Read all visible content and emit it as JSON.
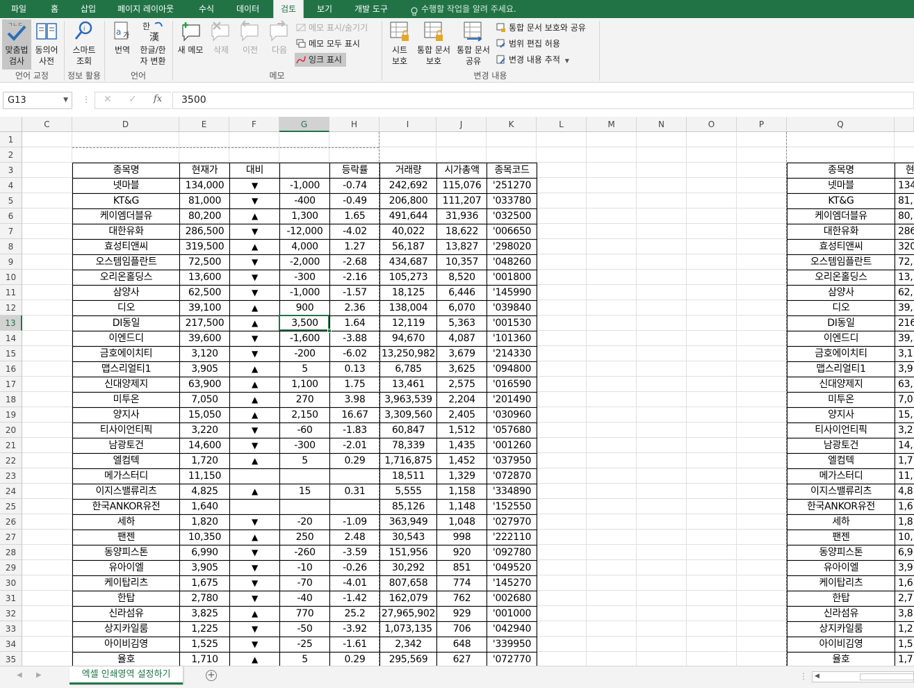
{
  "ribbon_tabs": [
    "파일",
    "홈",
    "삽입",
    "페이지 레이아웃",
    "수식",
    "데이터",
    "검토",
    "보기",
    "개발 도구"
  ],
  "active_tab": "검토",
  "tell_me": "수행할 작업을 알려 주세요.",
  "ribbon": {
    "spell": [
      "맞춤법",
      "검사"
    ],
    "thesaurus": [
      "동의어",
      "사전"
    ],
    "smart_lookup": [
      "스마트",
      "조회"
    ],
    "translate": "번역",
    "hanja": [
      "한글/한",
      "자 변환"
    ],
    "new_comment": "새 메모",
    "delete": "삭제",
    "previous": "이전",
    "next": "다음",
    "show_hide_comment": "메모 표시/숨기기",
    "show_all_comments": "메모 모두 표시",
    "show_ink": "잉크 표시",
    "protect_sheet": [
      "시트",
      "보호"
    ],
    "protect_workbook": [
      "통합 문서",
      "보호"
    ],
    "share_workbook": [
      "통합 문서",
      "공유"
    ],
    "protect_share": "통합 문서 보호와 공유",
    "allow_edit_ranges": "범위 편집 허용",
    "track_changes": "변경 내용 추적",
    "groups": [
      "언어 교정",
      "정보 활용",
      "언어",
      "메모",
      "변경 내용"
    ]
  },
  "name_box": "G13",
  "formula": "3500",
  "columns": [
    "C",
    "D",
    "E",
    "F",
    "G",
    "H",
    "I",
    "J",
    "K",
    "L",
    "M",
    "N",
    "O",
    "P",
    "Q"
  ],
  "rows": [
    "1",
    "2",
    "3",
    "4",
    "5",
    "6",
    "7",
    "8",
    "9",
    "10",
    "11",
    "12",
    "13",
    "14",
    "15",
    "16",
    "17",
    "18",
    "19",
    "20",
    "21",
    "22",
    "23",
    "24",
    "25",
    "26",
    "27",
    "28",
    "29",
    "30",
    "31",
    "32",
    "33",
    "34",
    "35"
  ],
  "table_header": [
    "종목명",
    "현재가",
    "대비",
    "",
    "등락률",
    "거래량",
    "시가총액",
    "종목코드"
  ],
  "table": [
    [
      "넷마블",
      "134,000",
      "▼",
      "-1,000",
      "-0.74",
      "242,692",
      "115,076",
      "'251270"
    ],
    [
      "KT&G",
      "81,000",
      "▼",
      "-400",
      "-0.49",
      "206,800",
      "111,207",
      "'033780"
    ],
    [
      "케이엠더블유",
      "80,200",
      "▲",
      "1,300",
      "1.65",
      "491,644",
      "31,936",
      "'032500"
    ],
    [
      "대한유화",
      "286,500",
      "▼",
      "-12,000",
      "-4.02",
      "40,022",
      "18,622",
      "'006650"
    ],
    [
      "효성티앤씨",
      "319,500",
      "▲",
      "4,000",
      "1.27",
      "56,187",
      "13,827",
      "'298020"
    ],
    [
      "오스템임플란트",
      "72,500",
      "▼",
      "-2,000",
      "-2.68",
      "434,687",
      "10,357",
      "'048260"
    ],
    [
      "오리온홀딩스",
      "13,600",
      "▼",
      "-300",
      "-2.16",
      "105,273",
      "8,520",
      "'001800"
    ],
    [
      "삼양사",
      "62,500",
      "▼",
      "-1,000",
      "-1.57",
      "18,125",
      "6,446",
      "'145990"
    ],
    [
      "디오",
      "39,100",
      "▲",
      "900",
      "2.36",
      "138,004",
      "6,070",
      "'039840"
    ],
    [
      "DI동일",
      "217,500",
      "▲",
      "3,500",
      "1.64",
      "12,119",
      "5,363",
      "'001530"
    ],
    [
      "이엔드디",
      "39,600",
      "▼",
      "-1,600",
      "-3.88",
      "94,670",
      "4,087",
      "'101360"
    ],
    [
      "금호에이치티",
      "3,120",
      "▼",
      "-200",
      "-6.02",
      "13,250,982",
      "3,679",
      "'214330"
    ],
    [
      "맵스리얼티1",
      "3,905",
      "▲",
      "5",
      "0.13",
      "6,785",
      "3,625",
      "'094800"
    ],
    [
      "신대양제지",
      "63,900",
      "▲",
      "1,100",
      "1.75",
      "13,461",
      "2,575",
      "'016590"
    ],
    [
      "미투온",
      "7,050",
      "▲",
      "270",
      "3.98",
      "3,963,539",
      "2,204",
      "'201490"
    ],
    [
      "양지사",
      "15,050",
      "▲",
      "2,150",
      "16.67",
      "3,309,560",
      "2,405",
      "'030960"
    ],
    [
      "티사이언티픽",
      "3,220",
      "▼",
      "-60",
      "-1.83",
      "60,847",
      "1,512",
      "'057680"
    ],
    [
      "남광토건",
      "14,600",
      "▼",
      "-300",
      "-2.01",
      "78,339",
      "1,435",
      "'001260"
    ],
    [
      "엘컴텍",
      "1,720",
      "▲",
      "5",
      "0.29",
      "1,716,875",
      "1,452",
      "'037950"
    ],
    [
      "메가스터디",
      "11,150",
      "",
      "",
      "",
      "18,511",
      "1,329",
      "'072870"
    ],
    [
      "이지스밸류리츠",
      "4,825",
      "▲",
      "15",
      "0.31",
      "5,555",
      "1,158",
      "'334890"
    ],
    [
      "한국ANKOR유전",
      "1,640",
      "",
      "",
      "",
      "85,126",
      "1,148",
      "'152550"
    ],
    [
      "세하",
      "1,820",
      "▼",
      "-20",
      "-1.09",
      "363,949",
      "1,048",
      "'027970"
    ],
    [
      "팬젠",
      "10,350",
      "▲",
      "250",
      "2.48",
      "30,543",
      "998",
      "'222110"
    ],
    [
      "동양피스톤",
      "6,990",
      "▼",
      "-260",
      "-3.59",
      "151,956",
      "920",
      "'092780"
    ],
    [
      "유아이엘",
      "3,905",
      "▼",
      "-10",
      "-0.26",
      "30,292",
      "851",
      "'049520"
    ],
    [
      "케이탑리츠",
      "1,675",
      "▼",
      "-70",
      "-4.01",
      "807,658",
      "774",
      "'145270"
    ],
    [
      "한탑",
      "2,780",
      "▼",
      "-40",
      "-1.42",
      "162,079",
      "762",
      "'002680"
    ],
    [
      "신라섬유",
      "3,825",
      "▲",
      "770",
      "25.2",
      "27,965,902",
      "929",
      "'001000"
    ],
    [
      "상지카일룸",
      "1,225",
      "▼",
      "-50",
      "-3.92",
      "1,073,135",
      "706",
      "'042940"
    ],
    [
      "아이비김영",
      "1,525",
      "▼",
      "-25",
      "-1.61",
      "2,342",
      "648",
      "'339950"
    ],
    [
      "율호",
      "1,710",
      "▲",
      "5",
      "0.29",
      "295,569",
      "627",
      "'072770"
    ]
  ],
  "q_header": [
    "종목명",
    "현"
  ],
  "q_table": [
    [
      "넷마블",
      "134"
    ],
    [
      "KT&G",
      "81,"
    ],
    [
      "케이엠더블유",
      "80,"
    ],
    [
      "대한유화",
      "286"
    ],
    [
      "효성티앤씨",
      "320"
    ],
    [
      "오스템임플란트",
      "72,"
    ],
    [
      "오리온홀딩스",
      "13,"
    ],
    [
      "삼양사",
      "62,"
    ],
    [
      "디오",
      "39,"
    ],
    [
      "DI동일",
      "216"
    ],
    [
      "이엔드디",
      "39,"
    ],
    [
      "금호에이치티",
      "3,1"
    ],
    [
      "맵스리얼티1",
      "3,9"
    ],
    [
      "신대양제지",
      "63,"
    ],
    [
      "미투온",
      "7,0"
    ],
    [
      "양지사",
      "15,"
    ],
    [
      "티사이언티픽",
      "3,2"
    ],
    [
      "남광토건",
      "14,"
    ],
    [
      "엘컴텍",
      "1,7"
    ],
    [
      "메가스터디",
      "11,"
    ],
    [
      "이지스밸류리츠",
      "4,8"
    ],
    [
      "한국ANKOR유전",
      "1,6"
    ],
    [
      "세하",
      "1,8"
    ],
    [
      "팬젠",
      "10,"
    ],
    [
      "동양피스톤",
      "6,9"
    ],
    [
      "유아이엘",
      "3,9"
    ],
    [
      "케이탑리츠",
      "1,6"
    ],
    [
      "한탑",
      "2,7"
    ],
    [
      "신라섬유",
      "3,8"
    ],
    [
      "상지카일룸",
      "1,2"
    ],
    [
      "아이비김영",
      "1,5"
    ],
    [
      "율호",
      "1,7"
    ]
  ],
  "sheet_tab": "엑셀 인쇄영역 설정하기",
  "colors": {
    "accent": "#217346",
    "selected_cell": "#217346"
  }
}
